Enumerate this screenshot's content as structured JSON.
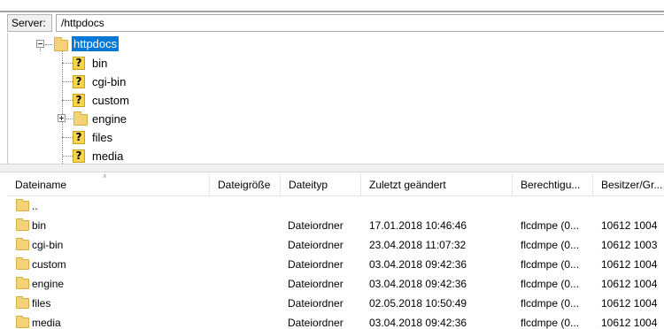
{
  "server_bar": {
    "label": "Server:",
    "path": "/httpdocs"
  },
  "tree": {
    "root": {
      "label": "httpdocs",
      "expanded": true,
      "selected": true
    },
    "children": [
      {
        "label": "bin",
        "icon": "unknown-folder-icon",
        "expandable": false
      },
      {
        "label": "cgi-bin",
        "icon": "unknown-folder-icon",
        "expandable": false
      },
      {
        "label": "custom",
        "icon": "unknown-folder-icon",
        "expandable": false
      },
      {
        "label": "engine",
        "icon": "folder-icon",
        "expandable": true
      },
      {
        "label": "files",
        "icon": "unknown-folder-icon",
        "expandable": false
      },
      {
        "label": "media",
        "icon": "unknown-folder-icon",
        "expandable": false
      }
    ],
    "unknown_glyph": "?"
  },
  "list": {
    "columns": [
      "Dateiname",
      "Dateigröße",
      "Dateityp",
      "Zuletzt geändert",
      "Berechtigu...",
      "Besitzer/Gr..."
    ],
    "sort_indicator": "^",
    "rows": [
      {
        "name": "..",
        "size": "",
        "type": "",
        "modified": "",
        "perms": "",
        "owner": ""
      },
      {
        "name": "bin",
        "size": "",
        "type": "Dateiordner",
        "modified": "17.01.2018 10:46:46",
        "perms": "flcdmpe (0...",
        "owner": "10612 1004"
      },
      {
        "name": "cgi-bin",
        "size": "",
        "type": "Dateiordner",
        "modified": "23.04.2018 11:07:32",
        "perms": "flcdmpe (0...",
        "owner": "10612 1003"
      },
      {
        "name": "custom",
        "size": "",
        "type": "Dateiordner",
        "modified": "03.04.2018 09:42:36",
        "perms": "flcdmpe (0...",
        "owner": "10612 1004"
      },
      {
        "name": "engine",
        "size": "",
        "type": "Dateiordner",
        "modified": "03.04.2018 09:42:36",
        "perms": "flcdmpe (0...",
        "owner": "10612 1004"
      },
      {
        "name": "files",
        "size": "",
        "type": "Dateiordner",
        "modified": "02.05.2018 10:50:49",
        "perms": "flcdmpe (0...",
        "owner": "10612 1004"
      },
      {
        "name": "media",
        "size": "",
        "type": "Dateiordner",
        "modified": "03.04.2018 09:42:36",
        "perms": "flcdmpe (0...",
        "owner": "10612 1004"
      }
    ]
  },
  "colors": {
    "selection": "#0078d7",
    "folder": "#f5d27a"
  }
}
